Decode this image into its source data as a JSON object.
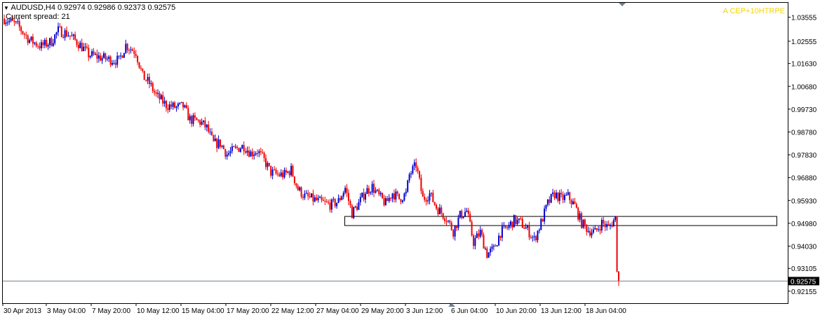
{
  "header": {
    "line1": "AUDUSD,H4  0.92974 0.92986 0.92373 0.92575",
    "spread": "Current spread: 21"
  },
  "indicator_label": "A CEP+10HTRPE",
  "colors": {
    "bull": "#0000cc",
    "bear": "#ee0000",
    "current_price_line": "#708090",
    "border": "#000000"
  },
  "chart_data": {
    "type": "candlestick",
    "symbol": "AUDUSD",
    "timeframe": "H4",
    "title": "",
    "xlabel": "",
    "ylabel": "",
    "ylim": [
      0.91655,
      1.04155
    ],
    "y_ticks": [
      1.03555,
      1.02555,
      1.0163,
      1.0068,
      0.9973,
      0.9878,
      0.9783,
      0.9688,
      0.9593,
      0.9498,
      0.9403,
      0.93105,
      0.92155
    ],
    "x_tick_labels": [
      "30 Apr 2013",
      "3 May 04:00",
      "7 May 20:00",
      "10 May 12:00",
      "15 May 04:00",
      "17 May 20:00",
      "22 May 12:00",
      "27 May 04:00",
      "29 May 20:00",
      "3 Jun 12:00",
      "6 Jun 04:00",
      "10 Jun 20:00",
      "13 Jun 12:00",
      "18 Jun 04:00"
    ],
    "current_price": 0.92575,
    "current_price_label": "0.92575",
    "last_bar": {
      "open": 0.92974,
      "high": 0.92986,
      "low": 0.92373,
      "close": 0.92575
    },
    "zone": {
      "x_start": "28 May 2013",
      "x_end": "right edge",
      "upper": 0.9528,
      "lower": 0.949
    },
    "series": [
      {
        "points": [
          [
            0,
            1.035
          ],
          [
            8,
            1.032
          ],
          [
            15,
            1.026
          ],
          [
            22,
            1.0235
          ],
          [
            28,
            1.0255
          ],
          [
            32,
            1.03
          ],
          [
            38,
            1.0285
          ],
          [
            45,
            1.024
          ],
          [
            50,
            1.02
          ],
          [
            56,
            1.019
          ],
          [
            62,
            1.018
          ],
          [
            68,
            1.0175
          ],
          [
            72,
            1.024
          ],
          [
            78,
            1.021
          ],
          [
            82,
            1.011
          ],
          [
            86,
            1.008
          ],
          [
            90,
            1.003
          ],
          [
            96,
            0.999
          ],
          [
            102,
            0.998
          ],
          [
            106,
            0.9985
          ],
          [
            110,
            0.993
          ],
          [
            116,
            0.992
          ],
          [
            120,
            0.9895
          ],
          [
            124,
            0.983
          ],
          [
            128,
            0.983
          ],
          [
            132,
            0.9785
          ],
          [
            138,
            0.981
          ],
          [
            142,
            0.982
          ],
          [
            146,
            0.979
          ],
          [
            150,
            0.98
          ],
          [
            154,
            0.976
          ],
          [
            158,
            0.971
          ],
          [
            162,
            0.97
          ],
          [
            166,
            0.97
          ],
          [
            170,
            0.972
          ],
          [
            174,
            0.964
          ],
          [
            178,
            0.961
          ],
          [
            182,
            0.96
          ],
          [
            186,
            0.959
          ],
          [
            190,
            0.958
          ],
          [
            194,
            0.9575
          ],
          [
            198,
            0.959
          ],
          [
            202,
            0.9645
          ],
          [
            206,
            0.954
          ],
          [
            210,
            0.958
          ],
          [
            214,
            0.963
          ],
          [
            218,
            0.965
          ],
          [
            222,
            0.961
          ],
          [
            226,
            0.958
          ],
          [
            230,
            0.9625
          ],
          [
            234,
            0.96
          ],
          [
            238,
            0.962
          ],
          [
            240,
            0.97
          ],
          [
            244,
            0.974
          ],
          [
            248,
            0.96
          ],
          [
            252,
            0.962
          ],
          [
            256,
            0.9565
          ],
          [
            262,
            0.952
          ],
          [
            266,
            0.9465
          ],
          [
            270,
            0.953
          ],
          [
            274,
            0.955
          ],
          [
            278,
            0.942
          ],
          [
            282,
            0.946
          ],
          [
            286,
            0.937
          ],
          [
            290,
            0.939
          ],
          [
            294,
            0.946
          ],
          [
            298,
            0.948
          ],
          [
            302,
            0.951
          ],
          [
            306,
            0.95
          ],
          [
            310,
            0.947
          ],
          [
            314,
            0.943
          ],
          [
            318,
            0.95
          ],
          [
            322,
            0.958
          ],
          [
            326,
            0.962
          ],
          [
            330,
            0.96
          ],
          [
            334,
            0.961
          ],
          [
            338,
            0.957
          ],
          [
            342,
            0.95
          ],
          [
            346,
            0.947
          ],
          [
            350,
            0.946
          ],
          [
            354,
            0.95
          ],
          [
            358,
            0.948
          ],
          [
            362,
            0.952
          ],
          [
            363,
            0.9297
          ],
          [
            364,
            0.92575
          ]
        ]
      }
    ]
  }
}
